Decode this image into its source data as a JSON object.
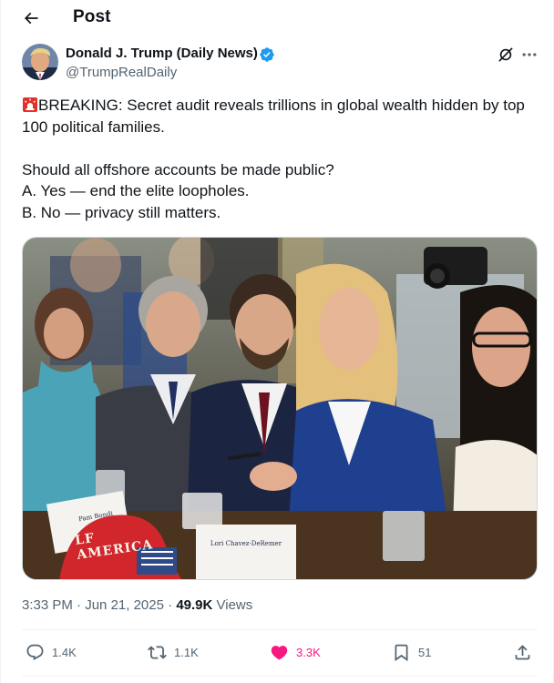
{
  "header": {
    "title": "Post",
    "back_icon": "arrow-left-icon"
  },
  "author": {
    "display_name": "Donald J. Trump (Daily News)",
    "handle": "@TrumpRealDaily",
    "verified_color": "#1d9bf0"
  },
  "tweet": {
    "emoji": "rotating-light-icon",
    "lines": [
      "BREAKING: Secret audit reveals trillions in global wealth hidden by top 100 political families.",
      "",
      "Should all offshore accounts be made public?",
      "A. Yes — end the elite loopholes.",
      "B. No — privacy still matters."
    ]
  },
  "media": {
    "placards": [
      "Pam Bondi",
      "Lori Chavez-DeRemer"
    ],
    "hat_text": "LF AMERICA"
  },
  "meta": {
    "time": "3:33 PM",
    "date": "Jun 21, 2025",
    "views_count": "49.9K",
    "views_label": "Views"
  },
  "actions": {
    "replies": "1.4K",
    "reposts": "1.1K",
    "likes": "3.3K",
    "bookmarks": "51",
    "like_color": "#f91880",
    "icon_color": "#536471"
  }
}
